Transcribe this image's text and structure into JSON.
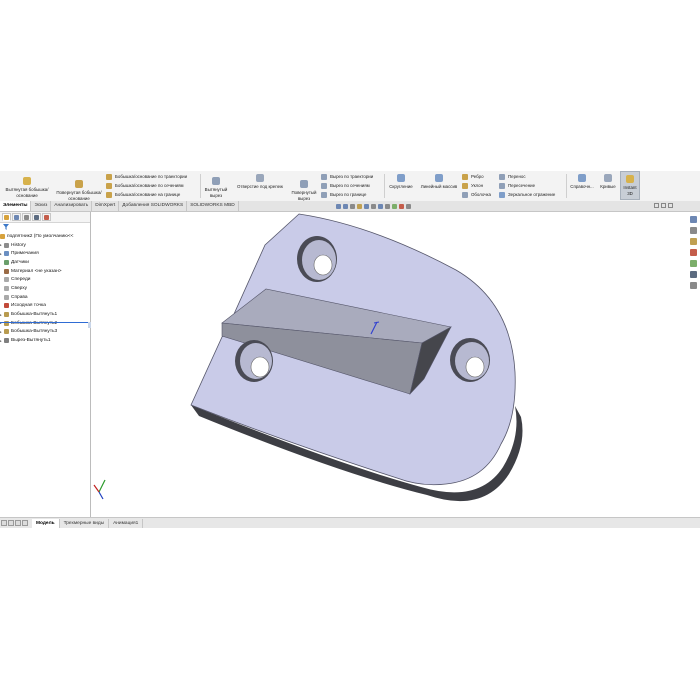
{
  "ribbon": {
    "extruded_boss": "Вытянутая бобышка/основание",
    "revolved_boss": "Повернутая бобышка/основание",
    "swept_boss": "Бобышка/основание по траектории",
    "lofted_boss": "Бобышка/основание по сечениям",
    "boundary_boss": "Бобышка/основание на границе",
    "extruded_cut": "Вытянутый вырез",
    "hole_wizard": "Отверстие под крепеж",
    "revolved_cut": "Повернутый вырез",
    "swept_cut": "Вырез по траектории",
    "lofted_cut": "Вырез по сечениям",
    "boundary_cut": "Вырез по границе",
    "fillet": "Скругление",
    "linear_pattern": "Линейный массив",
    "rib": "Ребро",
    "draft": "Уклон",
    "shell": "Оболочка",
    "wrap": "Перенос",
    "intersect": "Пересечение",
    "mirror": "Зеркальное отражение",
    "reference_geometry": "Справочн...",
    "curves": "Кривые",
    "instant3d": "Instant 3D"
  },
  "tabs": [
    "Элементы",
    "Эскиз",
    "Анализировать",
    "DimXpert",
    "Добавления SOLIDWORKS",
    "SOLIDWORKS MBD"
  ],
  "tree": {
    "root": "подпятник2  (По умолчанию<<",
    "items": [
      {
        "label": "History",
        "arrow": "▸",
        "color": "#8c8c8c"
      },
      {
        "label": "Примечания",
        "arrow": "▸",
        "color": "#6b8fc2"
      },
      {
        "label": "Датчики",
        "arrow": "",
        "color": "#6a9f6a"
      },
      {
        "label": "Материал <не указан>",
        "arrow": "",
        "color": "#9a6b45"
      },
      {
        "label": "Спереди",
        "arrow": "",
        "color": "#a9a9a9"
      },
      {
        "label": "Сверху",
        "arrow": "",
        "color": "#a9a9a9"
      },
      {
        "label": "Справа",
        "arrow": "",
        "color": "#a9a9a9"
      },
      {
        "label": "Исходная точка",
        "arrow": "",
        "color": "#c24a3a"
      },
      {
        "label": "Бобышка-Вытянуть1",
        "arrow": "▸",
        "color": "#b89b4f"
      },
      {
        "label": "Бобышка-Вытянуть2",
        "arrow": "▸",
        "color": "#b89b4f"
      },
      {
        "label": "Бобышка-Вытянуть3",
        "arrow": "▸",
        "color": "#b89b4f"
      },
      {
        "label": "Вырез-Вытянуть1",
        "arrow": "▸",
        "color": "#7f7f7f"
      }
    ]
  },
  "bottom_tabs": [
    "Модель",
    "Трехмерные виды",
    "Анимация1"
  ],
  "colors": {
    "accent": "#2f6cd4",
    "part_face": "#c9cbe8",
    "part_dark": "#3d3e44"
  }
}
